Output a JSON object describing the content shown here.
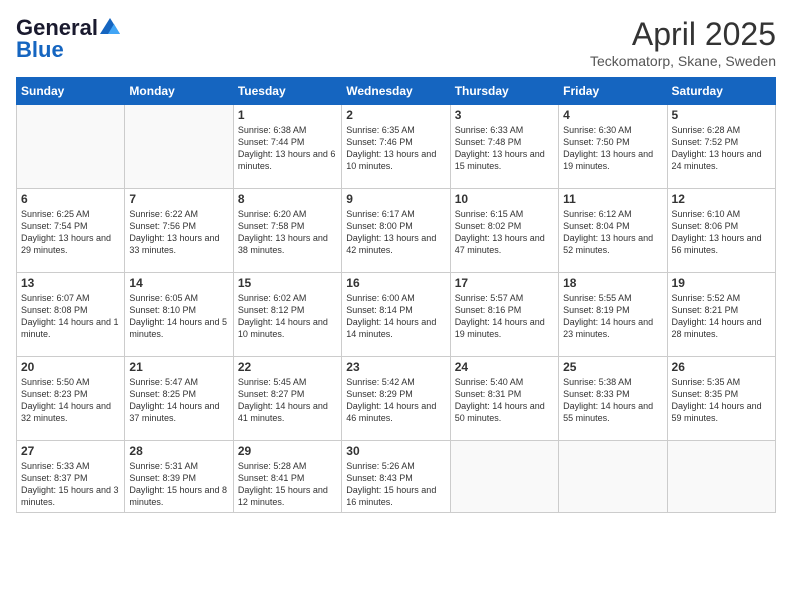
{
  "logo": {
    "line1": "General",
    "line2": "Blue"
  },
  "title": "April 2025",
  "subtitle": "Teckomatorp, Skane, Sweden",
  "weekdays": [
    "Sunday",
    "Monday",
    "Tuesday",
    "Wednesday",
    "Thursday",
    "Friday",
    "Saturday"
  ],
  "weeks": [
    [
      {
        "day": "",
        "info": ""
      },
      {
        "day": "",
        "info": ""
      },
      {
        "day": "1",
        "info": "Sunrise: 6:38 AM\nSunset: 7:44 PM\nDaylight: 13 hours and 6 minutes."
      },
      {
        "day": "2",
        "info": "Sunrise: 6:35 AM\nSunset: 7:46 PM\nDaylight: 13 hours and 10 minutes."
      },
      {
        "day": "3",
        "info": "Sunrise: 6:33 AM\nSunset: 7:48 PM\nDaylight: 13 hours and 15 minutes."
      },
      {
        "day": "4",
        "info": "Sunrise: 6:30 AM\nSunset: 7:50 PM\nDaylight: 13 hours and 19 minutes."
      },
      {
        "day": "5",
        "info": "Sunrise: 6:28 AM\nSunset: 7:52 PM\nDaylight: 13 hours and 24 minutes."
      }
    ],
    [
      {
        "day": "6",
        "info": "Sunrise: 6:25 AM\nSunset: 7:54 PM\nDaylight: 13 hours and 29 minutes."
      },
      {
        "day": "7",
        "info": "Sunrise: 6:22 AM\nSunset: 7:56 PM\nDaylight: 13 hours and 33 minutes."
      },
      {
        "day": "8",
        "info": "Sunrise: 6:20 AM\nSunset: 7:58 PM\nDaylight: 13 hours and 38 minutes."
      },
      {
        "day": "9",
        "info": "Sunrise: 6:17 AM\nSunset: 8:00 PM\nDaylight: 13 hours and 42 minutes."
      },
      {
        "day": "10",
        "info": "Sunrise: 6:15 AM\nSunset: 8:02 PM\nDaylight: 13 hours and 47 minutes."
      },
      {
        "day": "11",
        "info": "Sunrise: 6:12 AM\nSunset: 8:04 PM\nDaylight: 13 hours and 52 minutes."
      },
      {
        "day": "12",
        "info": "Sunrise: 6:10 AM\nSunset: 8:06 PM\nDaylight: 13 hours and 56 minutes."
      }
    ],
    [
      {
        "day": "13",
        "info": "Sunrise: 6:07 AM\nSunset: 8:08 PM\nDaylight: 14 hours and 1 minute."
      },
      {
        "day": "14",
        "info": "Sunrise: 6:05 AM\nSunset: 8:10 PM\nDaylight: 14 hours and 5 minutes."
      },
      {
        "day": "15",
        "info": "Sunrise: 6:02 AM\nSunset: 8:12 PM\nDaylight: 14 hours and 10 minutes."
      },
      {
        "day": "16",
        "info": "Sunrise: 6:00 AM\nSunset: 8:14 PM\nDaylight: 14 hours and 14 minutes."
      },
      {
        "day": "17",
        "info": "Sunrise: 5:57 AM\nSunset: 8:16 PM\nDaylight: 14 hours and 19 minutes."
      },
      {
        "day": "18",
        "info": "Sunrise: 5:55 AM\nSunset: 8:19 PM\nDaylight: 14 hours and 23 minutes."
      },
      {
        "day": "19",
        "info": "Sunrise: 5:52 AM\nSunset: 8:21 PM\nDaylight: 14 hours and 28 minutes."
      }
    ],
    [
      {
        "day": "20",
        "info": "Sunrise: 5:50 AM\nSunset: 8:23 PM\nDaylight: 14 hours and 32 minutes."
      },
      {
        "day": "21",
        "info": "Sunrise: 5:47 AM\nSunset: 8:25 PM\nDaylight: 14 hours and 37 minutes."
      },
      {
        "day": "22",
        "info": "Sunrise: 5:45 AM\nSunset: 8:27 PM\nDaylight: 14 hours and 41 minutes."
      },
      {
        "day": "23",
        "info": "Sunrise: 5:42 AM\nSunset: 8:29 PM\nDaylight: 14 hours and 46 minutes."
      },
      {
        "day": "24",
        "info": "Sunrise: 5:40 AM\nSunset: 8:31 PM\nDaylight: 14 hours and 50 minutes."
      },
      {
        "day": "25",
        "info": "Sunrise: 5:38 AM\nSunset: 8:33 PM\nDaylight: 14 hours and 55 minutes."
      },
      {
        "day": "26",
        "info": "Sunrise: 5:35 AM\nSunset: 8:35 PM\nDaylight: 14 hours and 59 minutes."
      }
    ],
    [
      {
        "day": "27",
        "info": "Sunrise: 5:33 AM\nSunset: 8:37 PM\nDaylight: 15 hours and 3 minutes."
      },
      {
        "day": "28",
        "info": "Sunrise: 5:31 AM\nSunset: 8:39 PM\nDaylight: 15 hours and 8 minutes."
      },
      {
        "day": "29",
        "info": "Sunrise: 5:28 AM\nSunset: 8:41 PM\nDaylight: 15 hours and 12 minutes."
      },
      {
        "day": "30",
        "info": "Sunrise: 5:26 AM\nSunset: 8:43 PM\nDaylight: 15 hours and 16 minutes."
      },
      {
        "day": "",
        "info": ""
      },
      {
        "day": "",
        "info": ""
      },
      {
        "day": "",
        "info": ""
      }
    ]
  ]
}
